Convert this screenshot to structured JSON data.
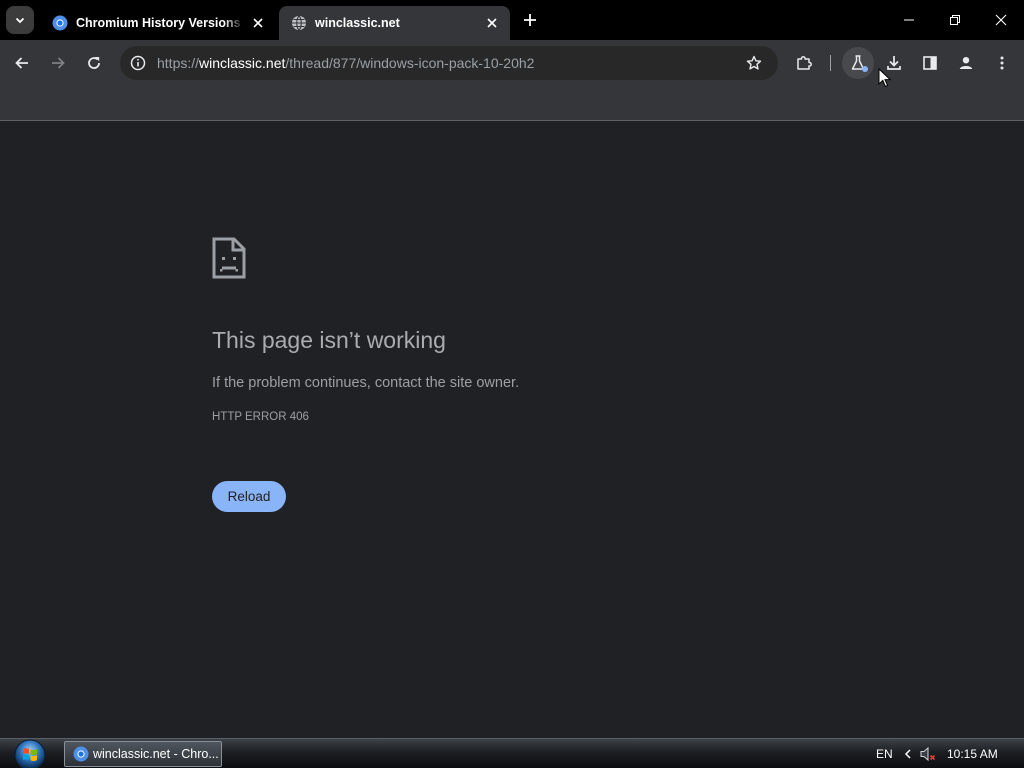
{
  "tabs": [
    {
      "title": "Chromium History Versions Do",
      "active": false,
      "favicon": "chromium-icon"
    },
    {
      "title": "winclassic.net",
      "active": true,
      "favicon": "globe-icon"
    }
  ],
  "toolbar": {
    "url_scheme": "https://",
    "url_host": "winclassic.net",
    "url_path": "/thread/877/windows-icon-pack-10-20h2"
  },
  "error_page": {
    "title": "This page isn’t working",
    "message": "If the problem continues, contact the site owner.",
    "code": "HTTP ERROR 406",
    "reload_label": "Reload"
  },
  "taskbar": {
    "task_label": "winclassic.net - Chro...",
    "language": "EN",
    "clock": "10:15 AM"
  },
  "colors": {
    "accent": "#8ab4f8",
    "page_background": "#202124",
    "toolbar": "#35363a",
    "tabstrip": "#000000"
  },
  "icons": [
    "chevron-down-icon",
    "chromium-icon",
    "globe-icon",
    "close-icon",
    "plus-icon",
    "minimize-icon",
    "restore-icon",
    "back-arrow-icon",
    "forward-arrow-icon",
    "reload-icon",
    "info-icon",
    "star-icon",
    "extensions-icon",
    "labs-flask-icon",
    "download-icon",
    "side-panel-icon",
    "profile-icon",
    "more-vertical-icon",
    "sad-page-icon",
    "windows-orb-icon",
    "volume-muted-icon"
  ]
}
